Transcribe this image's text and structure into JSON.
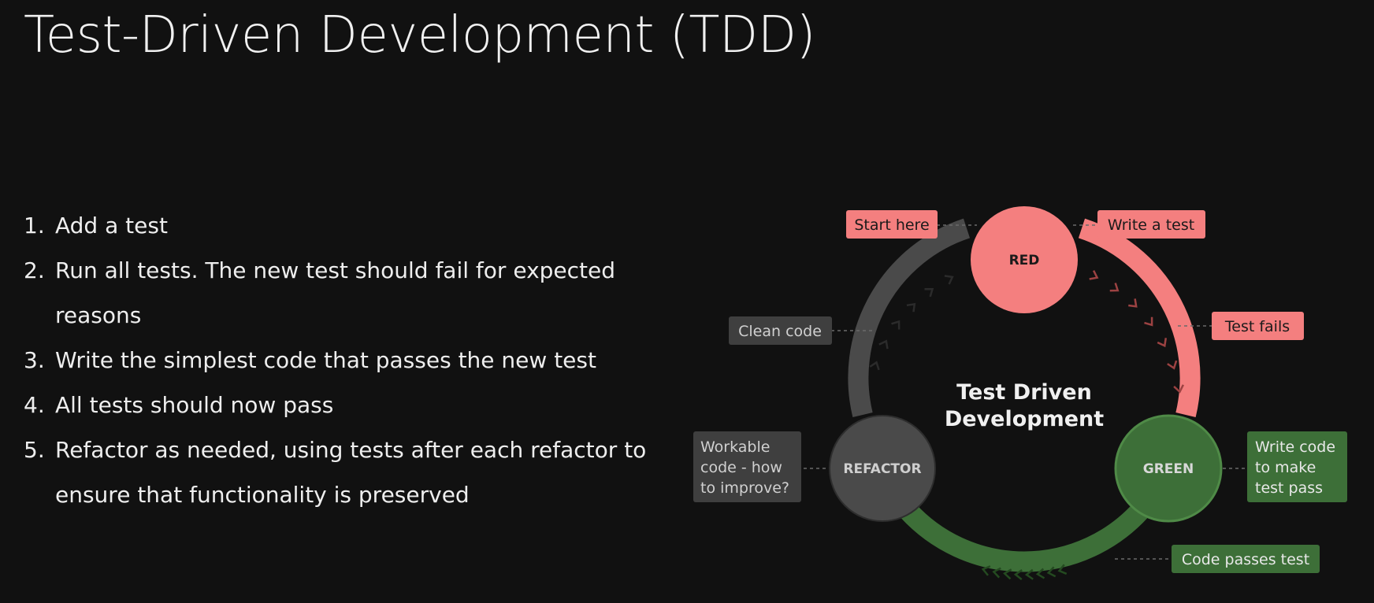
{
  "title": "Test-Driven Development (TDD)",
  "steps": [
    {
      "num": "1.",
      "text": "Add a test"
    },
    {
      "num": "2.",
      "text": "Run all tests. The new test should fail for expected reasons"
    },
    {
      "num": "3.",
      "text": "Write the simplest code that passes the new test"
    },
    {
      "num": "4.",
      "text": "All tests should now pass"
    },
    {
      "num": "5.",
      "text": "Refactor as needed, using tests after each refactor to ensure that functionality is preserved"
    }
  ],
  "diagram": {
    "center_line1": "Test Driven",
    "center_line2": "Development",
    "nodes": {
      "red": "RED",
      "green": "GREEN",
      "refactor": "REFACTOR"
    },
    "labels": {
      "start_here": "Start here",
      "write_a_test": "Write a test",
      "test_fails": "Test fails",
      "clean_code": "Clean code",
      "workable_line1": "Workable",
      "workable_line2": "code - how",
      "workable_line3": "to improve?",
      "write_code_line1": "Write code",
      "write_code_line2": "to make",
      "write_code_line3": "test pass",
      "code_passes": "Code passes test"
    },
    "colors": {
      "red": "#f47f7f",
      "green": "#3d6f38",
      "gray": "#4a4a4a",
      "background": "#111111"
    }
  }
}
